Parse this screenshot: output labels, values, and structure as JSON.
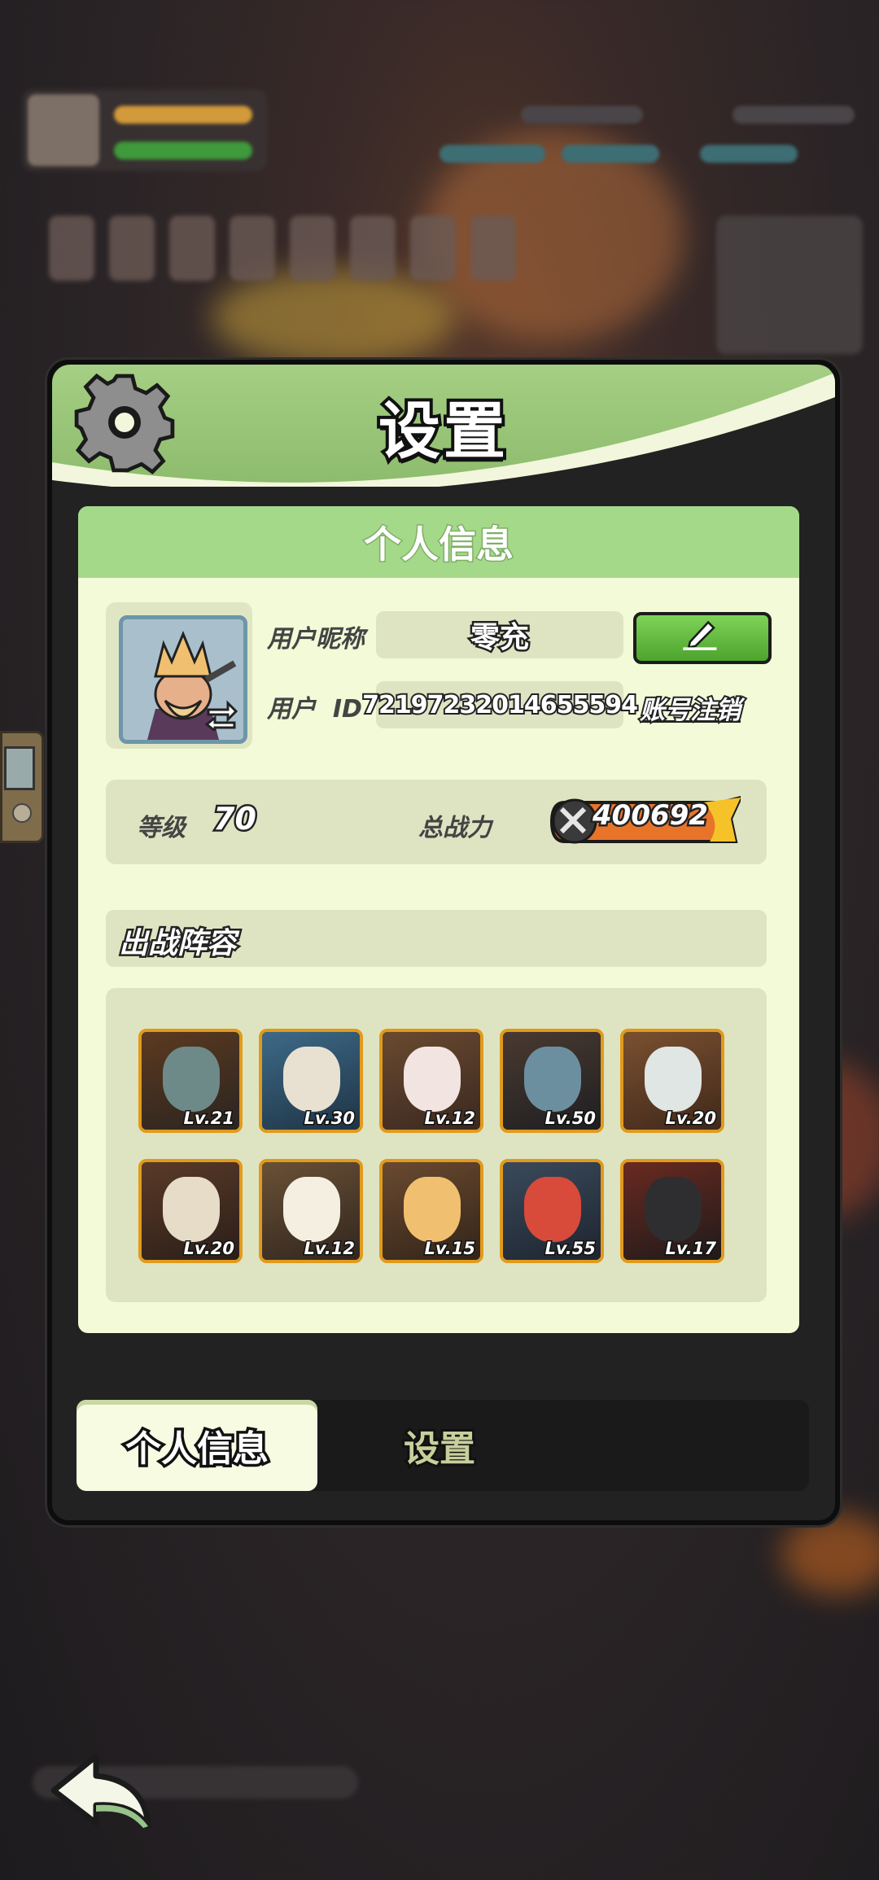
{
  "window": {
    "title": "设置"
  },
  "panel": {
    "title": "个人信息"
  },
  "profile": {
    "nickname_label": "用户昵称",
    "nickname": "零充",
    "id_label": "用户  ID",
    "user_id": "72197232014655594",
    "cancel_account": "账号注销",
    "edit_icon": "pencil-icon",
    "avatar_icon": "hero-avatar",
    "swap_icon": "swap-arrows-icon"
  },
  "stats": {
    "level_label": "等级",
    "level": "70",
    "power_label": "总战力",
    "power": "400692",
    "power_icon": "crossed-swords-icon"
  },
  "lineup": {
    "title": "出战阵容",
    "heroes": [
      {
        "level": "Lv.21"
      },
      {
        "level": "Lv.30"
      },
      {
        "level": "Lv.12"
      },
      {
        "level": "Lv.50"
      },
      {
        "level": "Lv.20"
      },
      {
        "level": "Lv.20"
      },
      {
        "level": "Lv.12"
      },
      {
        "level": "Lv.15"
      },
      {
        "level": "Lv.55"
      },
      {
        "level": "Lv.17"
      }
    ]
  },
  "tabs": [
    {
      "label": "个人信息",
      "active": true
    },
    {
      "label": "设置",
      "active": false
    }
  ],
  "colors": {
    "header_green": "#a5cf84",
    "panel_bg": "#f2fad8",
    "hero_border": "#e19a1c",
    "edit_green": "#5fbf3a"
  },
  "back_icon": "back-arrow-icon"
}
